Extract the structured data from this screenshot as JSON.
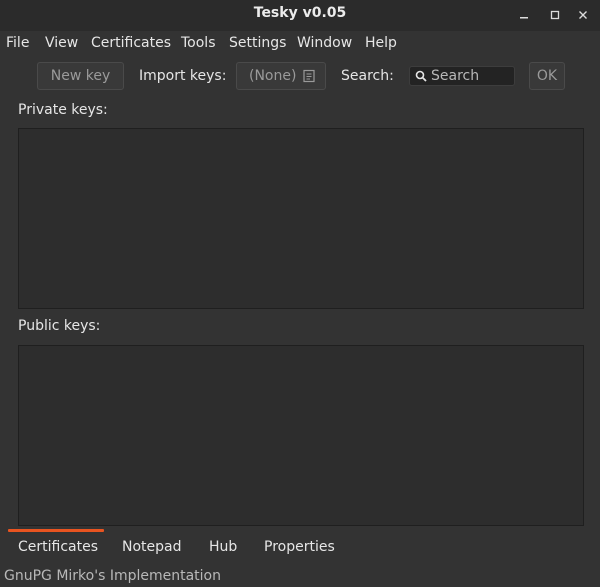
{
  "window": {
    "title": "Tesky v0.05",
    "controls": [
      "minimize",
      "maximize",
      "close"
    ]
  },
  "menu": [
    "File",
    "View",
    "Certificates",
    "Tools",
    "Settings",
    "Window",
    "Help"
  ],
  "toolbar": {
    "new_key": "New key",
    "import_label": "Import keys:",
    "import_value": "(None)",
    "search_label": "Search:",
    "search_placeholder": "Search",
    "ok": "OK"
  },
  "sections": {
    "private_keys": "Private keys:",
    "public_keys": "Public keys:"
  },
  "tabs": [
    "Certificates",
    "Notepad",
    "Hub",
    "Properties"
  ],
  "active_tab": "Certificates",
  "status": "GnuPG Mirko's Implementation",
  "colors": {
    "accent": "#e95420",
    "window_bg": "#333333",
    "list_bg": "#2d2d2d"
  },
  "icons": [
    "minimize-icon",
    "maximize-icon",
    "close-icon",
    "file-browse-icon",
    "search-icon"
  ]
}
